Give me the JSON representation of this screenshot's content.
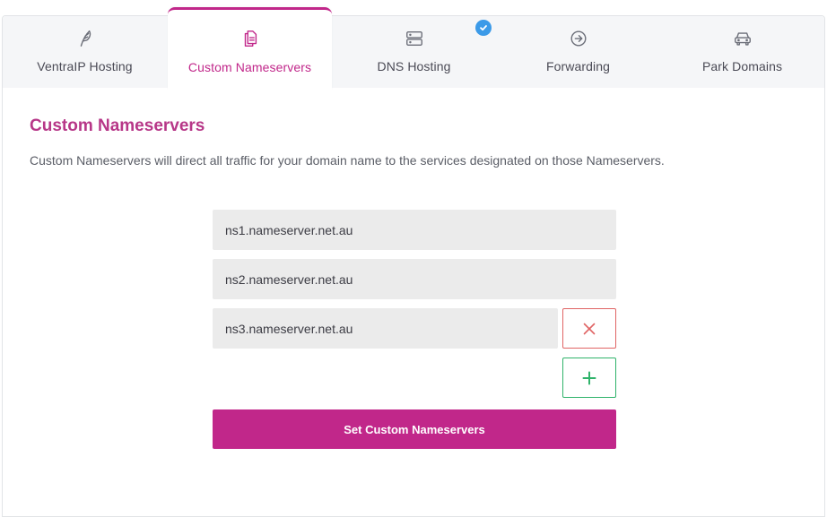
{
  "tabs": [
    {
      "label": "VentraIP Hosting",
      "icon": "feather-icon"
    },
    {
      "label": "Custom Nameservers",
      "icon": "documents-icon",
      "active": true
    },
    {
      "label": "DNS Hosting",
      "icon": "server-icon",
      "badge": "check-icon"
    },
    {
      "label": "Forwarding",
      "icon": "arrow-circle-icon"
    },
    {
      "label": "Park Domains",
      "icon": "car-icon"
    }
  ],
  "section": {
    "title": "Custom Nameservers",
    "description": "Custom Nameservers will direct all traffic for your domain name to the services designated on those Nameservers."
  },
  "nameservers": [
    {
      "value": "ns1.nameserver.net.au"
    },
    {
      "value": "ns2.nameserver.net.au"
    },
    {
      "value": "ns3.nameserver.net.au"
    }
  ],
  "actions": {
    "remove_icon": "close-icon",
    "add_icon": "plus-icon",
    "submit_label": "Set Custom Nameservers"
  },
  "colors": {
    "accent": "#c1278a",
    "remove": "#e06464",
    "add": "#2fb36a",
    "badge": "#3b9ae8"
  }
}
